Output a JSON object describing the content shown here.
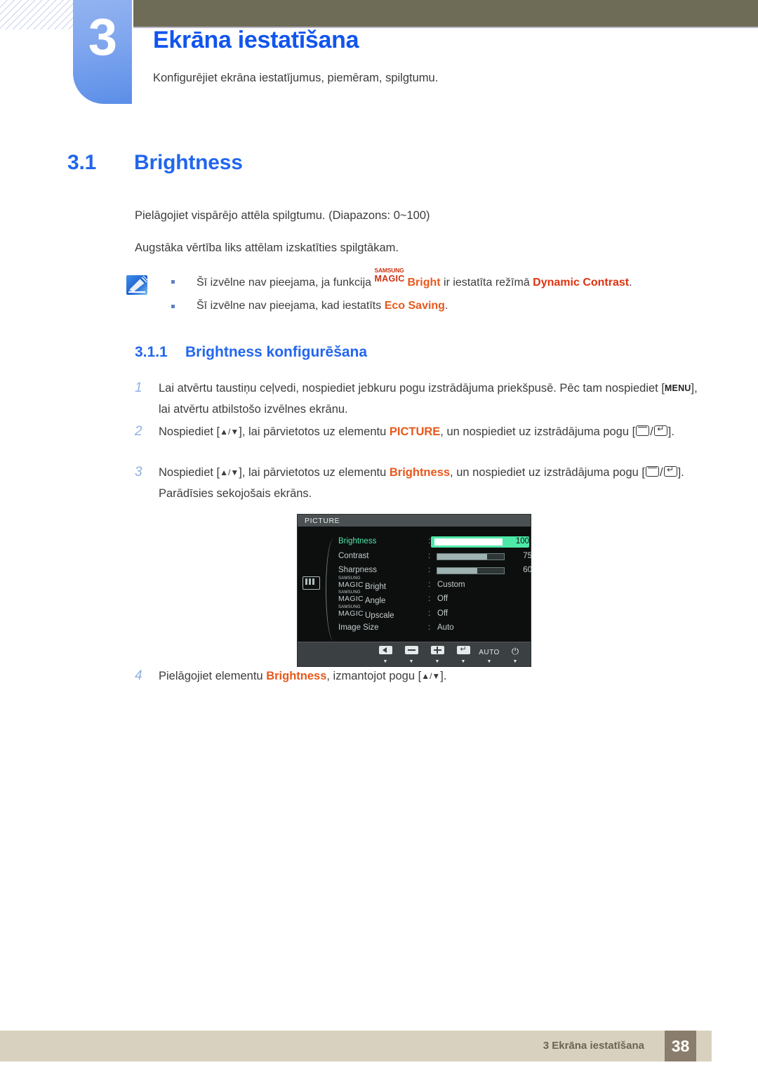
{
  "header": {
    "chapter_number": "3",
    "chapter_title": "Ekrāna iestatīšana",
    "chapter_subtitle": "Konfigurējiet ekrāna iestatījumus, piemēram, spilgtumu.",
    "bar_color": "#6e6c57",
    "tab_color": "#7ea5ee",
    "title_color": "#1155ee"
  },
  "section": {
    "number": "3.1",
    "title": "Brightness",
    "paragraph_1": "Pielāgojiet vispārējo attēla spilgtumu. (Diapazons: 0~100)",
    "paragraph_2": "Augstāka vērtība liks attēlam izskatīties spilgtākam."
  },
  "note": {
    "icon": "note-pencil-icon",
    "items": [
      {
        "prefix": "Šī izvēlne nav pieejama, ja funkcija ",
        "magic_top": "SAMSUNG",
        "magic_bottom": "MAGIC",
        "magic_suffix": "Bright",
        "middle": " ir iestatīta režīmā ",
        "highlight": "Dynamic Contrast",
        "suffix": "."
      },
      {
        "prefix": "Šī izvēlne nav pieejama, kad iestatīts ",
        "highlight": "Eco Saving",
        "suffix": "."
      }
    ]
  },
  "subsection": {
    "number": "3.1.1",
    "title": "Brightness konfigurēšana"
  },
  "steps": [
    {
      "number": "1",
      "part_a": "Lai atvērtu taustiņu ceļvedi, nospiediet jebkuru pogu izstrādājuma priekšpusē. Pēc tam nospiediet [",
      "key": "MENU",
      "part_b": "], lai atvērtu atbilstošo izvēlnes ekrānu."
    },
    {
      "number": "2",
      "part_a": "Nospiediet [",
      "arrows": "▲/▼",
      "part_b": "], lai pārvietotos uz elementu ",
      "highlight": "PICTURE",
      "part_c": ", un nospiediet uz izstrādājuma pogu [",
      "part_d": "]."
    },
    {
      "number": "3",
      "part_a": "Nospiediet [",
      "arrows": "▲/▼",
      "part_b": "], lai pārvietotos uz elementu ",
      "highlight": "Brightness",
      "part_c": ", un nospiediet uz izstrādājuma pogu [",
      "part_d": "]. Parādīsies sekojošais ekrāns."
    },
    {
      "number": "4",
      "part_a": "Pielāgojiet elementu ",
      "highlight": "Brightness",
      "part_b": ", izmantojot pogu [",
      "arrows": "▲/▼",
      "part_c": "]."
    }
  ],
  "osd": {
    "title": "PICTURE",
    "side_icon": "picture-bars-icon",
    "scroll_more": "▼",
    "rows": [
      {
        "label": "Brightness",
        "type": "slider",
        "value": "100",
        "percent": 100,
        "selected": true
      },
      {
        "label": "Contrast",
        "type": "slider",
        "value": "75",
        "percent": 75,
        "selected": false
      },
      {
        "label": "Sharpness",
        "type": "slider",
        "value": "60",
        "percent": 60,
        "selected": false
      },
      {
        "label": "Bright",
        "type": "value",
        "magic_top": "SAMSUNG",
        "magic_bottom": "MAGIC",
        "value": "Custom",
        "selected": false
      },
      {
        "label": "Angle",
        "type": "value",
        "magic_top": "SAMSUNG",
        "magic_bottom": "MAGIC",
        "value": "Off",
        "selected": false
      },
      {
        "label": "Upscale",
        "type": "value",
        "magic_top": "SAMSUNG",
        "magic_bottom": "MAGIC",
        "value": "Off",
        "selected": false
      },
      {
        "label": "Image Size",
        "type": "value",
        "value": "Auto",
        "selected": false
      }
    ],
    "buttons": [
      {
        "icon": "left-arrow-icon",
        "label": ""
      },
      {
        "icon": "minus-icon",
        "label": ""
      },
      {
        "icon": "plus-icon",
        "label": ""
      },
      {
        "icon": "enter-icon",
        "label": ""
      },
      {
        "icon": "auto-text",
        "label": "AUTO"
      },
      {
        "icon": "power-icon",
        "label": "⏻"
      }
    ],
    "highlight_color": "#4ee8a8",
    "background_color": "#0d0f0f"
  },
  "footer": {
    "text": "3 Ekrāna iestatīšana",
    "page_number": "38",
    "bar_color": "#d8d1bf",
    "page_box_color": "#8b7d6d"
  }
}
